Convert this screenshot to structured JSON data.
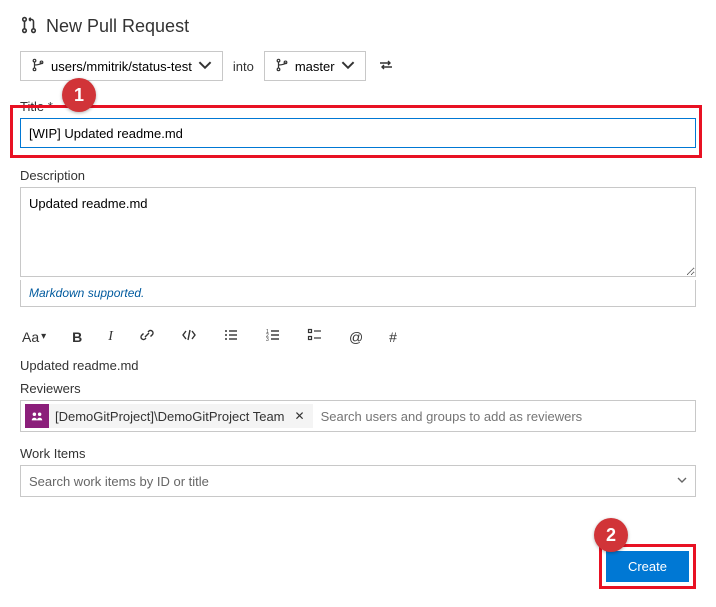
{
  "header": {
    "title": "New Pull Request"
  },
  "branches": {
    "source": "users/mmitrik/status-test",
    "into_label": "into",
    "target": "master"
  },
  "title_field": {
    "label": "Title",
    "value": "[WIP] Updated readme.md"
  },
  "description_field": {
    "label": "Description",
    "value": "Updated readme.md",
    "note": "Markdown supported."
  },
  "preview_text": "Updated readme.md",
  "reviewers": {
    "label": "Reviewers",
    "chip_text": "[DemoGitProject]\\DemoGitProject Team",
    "placeholder": "Search users and groups to add as reviewers"
  },
  "work_items": {
    "label": "Work Items",
    "placeholder": "Search work items by ID or title"
  },
  "actions": {
    "create": "Create"
  },
  "callouts": {
    "one": "1",
    "two": "2"
  },
  "toolbar": {
    "text_size": "Aa",
    "bold": "B",
    "italic": "I",
    "at": "@",
    "hash": "#"
  }
}
